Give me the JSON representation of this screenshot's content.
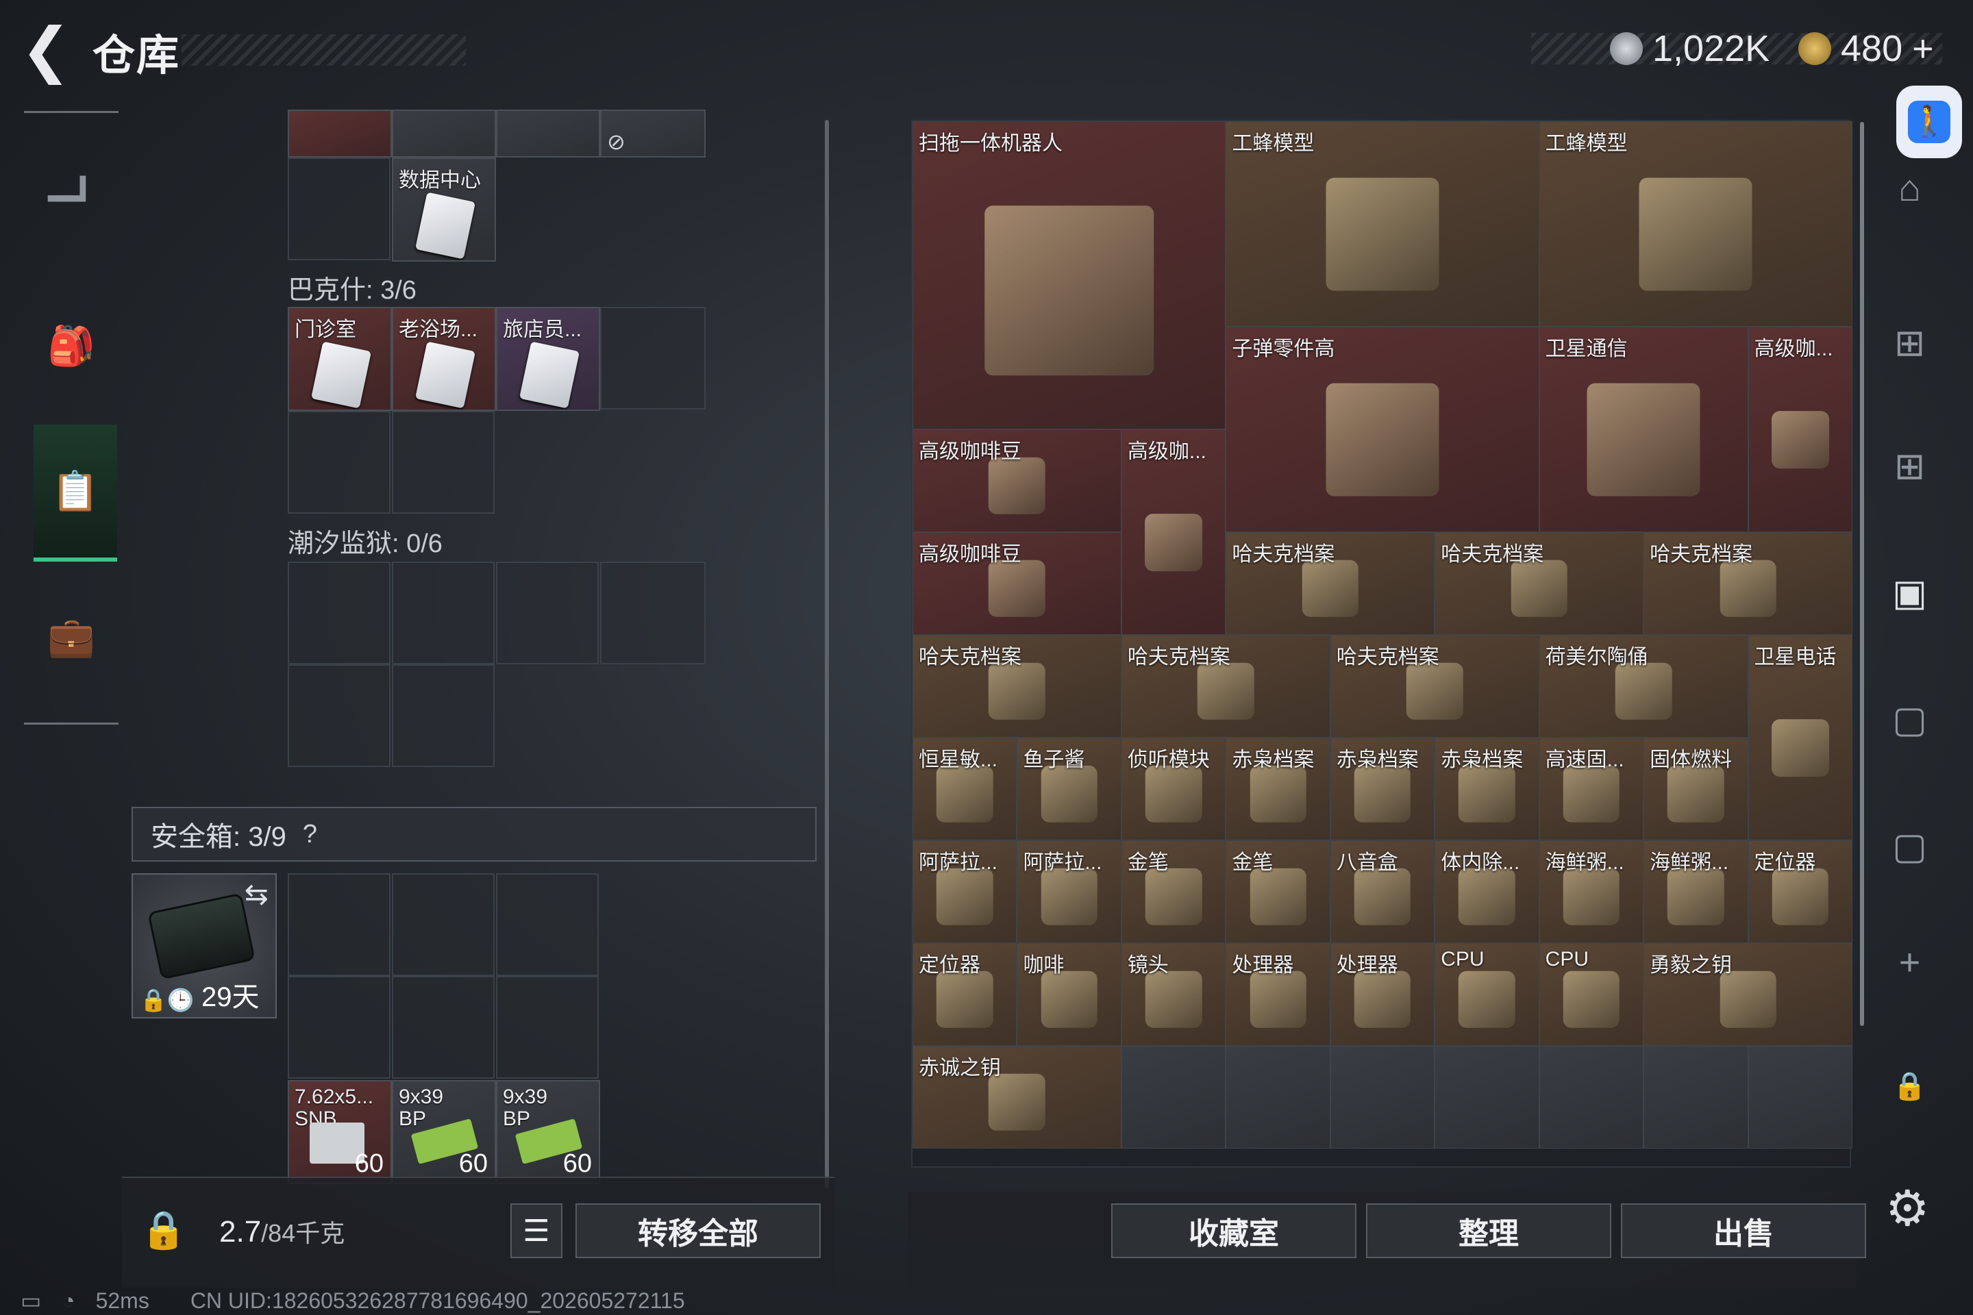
{
  "header": {
    "back_icon": "back-arrow-icon",
    "title": "仓库",
    "currency1": {
      "icon": "silver-coin-icon",
      "value": "1,022K"
    },
    "currency2": {
      "icon": "gold-coin-icon",
      "value": "480",
      "plus": "+"
    }
  },
  "accessibility": {
    "icon": "accessibility-icon"
  },
  "left_tabs": [
    "pistol-icon",
    "backpack-icon",
    "clipboard-icon",
    "briefcase-icon"
  ],
  "right_tabs": [
    "home-icon",
    "add-tab-icon",
    "add-tab-icon",
    "camera-tab-icon",
    "tab-icon",
    "tab-icon",
    "plus-icon",
    "lock-icon"
  ],
  "keys": {
    "top_label": "数据中心",
    "section1": "巴克什: 3/6",
    "section1_items": [
      "门诊室",
      "老浴场...",
      "旅店员..."
    ],
    "section2": "潮汐监狱: 0/6"
  },
  "safe": {
    "label": "安全箱: 3/9",
    "help": "?",
    "timer": "29天"
  },
  "ammo": [
    {
      "name": "7.62x5...",
      "sub": "SNB",
      "count": "60"
    },
    {
      "name": "9x39",
      "sub": "BP",
      "count": "60"
    },
    {
      "name": "9x39",
      "sub": "BP",
      "count": "60"
    }
  ],
  "footer_left": {
    "weight": "2.7",
    "weight_max": "/84千克",
    "transfer": "转移全部"
  },
  "footer_right": {
    "collect": "收藏室",
    "sort": "整理",
    "sell": "出售"
  },
  "status": {
    "ping": "52ms",
    "uid": "CN UID:18260532628778169649​0_202605272115"
  },
  "stash_items": [
    {
      "name": "扫拖一体机器人",
      "r": "red"
    },
    {
      "name": "工蜂模型",
      "r": "gold"
    },
    {
      "name": "工蜂模型",
      "r": "gold"
    },
    {
      "name": "子弹零件高",
      "r": "red"
    },
    {
      "name": "卫星通信",
      "r": "red"
    },
    {
      "name": "高级咖...",
      "r": "red"
    },
    {
      "name": "高级咖啡豆",
      "r": "red"
    },
    {
      "name": "高级咖...",
      "r": "red"
    },
    {
      "name": "高级咖啡豆",
      "r": "red"
    },
    {
      "name": "哈夫克档案",
      "r": "gold"
    },
    {
      "name": "哈夫克档案",
      "r": "gold"
    },
    {
      "name": "哈夫克档案",
      "r": "gold"
    },
    {
      "name": "哈夫克档案",
      "r": "gold"
    },
    {
      "name": "哈夫克档案",
      "r": "gold"
    },
    {
      "name": "哈夫克档案",
      "r": "gold"
    },
    {
      "name": "荷美尔陶俑",
      "r": "gold"
    },
    {
      "name": "卫星电话",
      "r": "gold"
    },
    {
      "name": "恒星敏...",
      "r": "gold"
    },
    {
      "name": "鱼子酱",
      "r": "gold"
    },
    {
      "name": "侦听模块",
      "r": "gold"
    },
    {
      "name": "赤枭档案",
      "r": "gold"
    },
    {
      "name": "赤枭档案",
      "r": "gold"
    },
    {
      "name": "赤枭档案",
      "r": "gold"
    },
    {
      "name": "高速固...",
      "r": "gold"
    },
    {
      "name": "固体燃料",
      "r": "gold"
    },
    {
      "name": "阿萨拉...",
      "r": "gold"
    },
    {
      "name": "阿萨拉...",
      "r": "gold"
    },
    {
      "name": "金笔",
      "r": "gold"
    },
    {
      "name": "金笔",
      "r": "gold"
    },
    {
      "name": "八音盒",
      "r": "gold"
    },
    {
      "name": "体内除...",
      "r": "gold"
    },
    {
      "name": "海鲜粥...",
      "r": "gold"
    },
    {
      "name": "海鲜粥...",
      "r": "gold"
    },
    {
      "name": "定位器",
      "r": "gold"
    },
    {
      "name": "定位器",
      "r": "gold"
    },
    {
      "name": "咖啡",
      "r": "gold"
    },
    {
      "name": "镜头",
      "r": "gold"
    },
    {
      "name": "处理器",
      "r": "gold"
    },
    {
      "name": "处理器",
      "r": "gold"
    },
    {
      "name": "CPU",
      "r": "gold"
    },
    {
      "name": "CPU",
      "r": "gold"
    },
    {
      "name": "勇毅之钥",
      "r": "gold"
    },
    {
      "name": "赤诚之钥",
      "r": "gold"
    }
  ]
}
